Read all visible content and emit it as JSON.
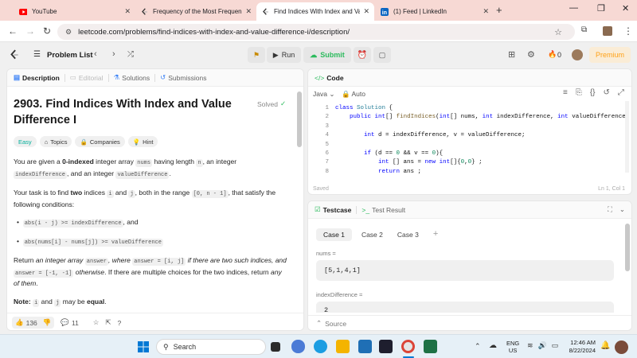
{
  "browser": {
    "tabs": [
      {
        "title": "YouTube",
        "icon": "youtube-icon",
        "color": "#ff0000"
      },
      {
        "title": "Frequency of the Most Frequen",
        "icon": "leetcode-icon",
        "color": "#ffa116"
      },
      {
        "title": "Find Indices With Index and Val",
        "icon": "leetcode-icon",
        "color": "#ffa116"
      },
      {
        "title": "(1) Feed | LinkedIn",
        "icon": "linkedin-icon",
        "color": "#0a66c2"
      }
    ],
    "new_tab": "+",
    "url": "leetcode.com/problems/find-indices-with-index-and-value-difference-i/description/"
  },
  "toolbar": {
    "problem_list": "Problem List",
    "run": "Run",
    "submit": "Submit",
    "streak": "0",
    "premium": "Premium"
  },
  "left_tabs": [
    "Description",
    "Editorial",
    "Solutions",
    "Submissions"
  ],
  "problem": {
    "title": "2903. Find Indices With Index and Value Difference I",
    "status": "Solved",
    "difficulty": "Easy",
    "chips": [
      "Topics",
      "Companies",
      "Hint"
    ],
    "p1": {
      "a": "You are given a ",
      "b": "0-indexed",
      "c": " integer array ",
      "d": "nums",
      "e": " having length ",
      "f": "n",
      "g": ", an integer ",
      "h": "indexDifference",
      "i": ", and an integer ",
      "j": "valueDifference",
      "k": "."
    },
    "p2": {
      "a": "Your task is to find ",
      "b": "two",
      "c": " indices ",
      "d": "i",
      "e": " and ",
      "f": "j",
      "g": ", both in the range ",
      "h": "[0, n - 1]",
      "i": ", that satisfy the following conditions:"
    },
    "cond1": {
      "code": "abs(i - j) >= indexDifference",
      "tail": ", and"
    },
    "cond2": {
      "code": "abs(nums[i] - nums[j]) >= valueDifference"
    },
    "p3": {
      "a": "Return ",
      "b": "an integer array ",
      "c": "answer",
      "d": ", where ",
      "e": "answer = [i, j]",
      "f": " if there are two such indices, and ",
      "g": "answer = [-1, -1]",
      "h": " otherwise",
      "i": ". If there are multiple choices for the two indices, return ",
      "j": "any of them",
      "k": "."
    },
    "note": {
      "a": "Note: ",
      "b": "i",
      "c": " and ",
      "d": "j",
      "e": " may be ",
      "f": "equal",
      "g": "."
    }
  },
  "footer": {
    "likes": "136",
    "comments": "11"
  },
  "code_panel": {
    "title": "Code",
    "language": "Java",
    "format": "Auto",
    "saved": "Saved",
    "cursor": "Ln 1, Col 1",
    "lines": [
      {
        "n": "1",
        "text": "class Solution {"
      },
      {
        "n": "2",
        "text": "    public int[] findIndices(int[] nums, int indexDifference, int valueDifference) {"
      },
      {
        "n": "3",
        "text": ""
      },
      {
        "n": "4",
        "text": "        int d = indexDifference, v = valueDifference;"
      },
      {
        "n": "5",
        "text": ""
      },
      {
        "n": "6",
        "text": "        if (d == 0 && v == 0){"
      },
      {
        "n": "7",
        "text": "            int [] ans = new int[]{0,0} ;"
      },
      {
        "n": "8",
        "text": "            return ans ;"
      }
    ]
  },
  "testcase": {
    "tab1": "Testcase",
    "tab2": "Test Result",
    "cases": [
      "Case 1",
      "Case 2",
      "Case 3"
    ],
    "add": "+",
    "label1": "nums =",
    "value1": "[5,1,4,1]",
    "label2": "indexDifference =",
    "value2": "2",
    "source": "Source"
  },
  "taskbar": {
    "search": "Search",
    "lang1": "ENG",
    "lang2": "US",
    "time": "12:46 AM",
    "date": "8/22/2024"
  }
}
